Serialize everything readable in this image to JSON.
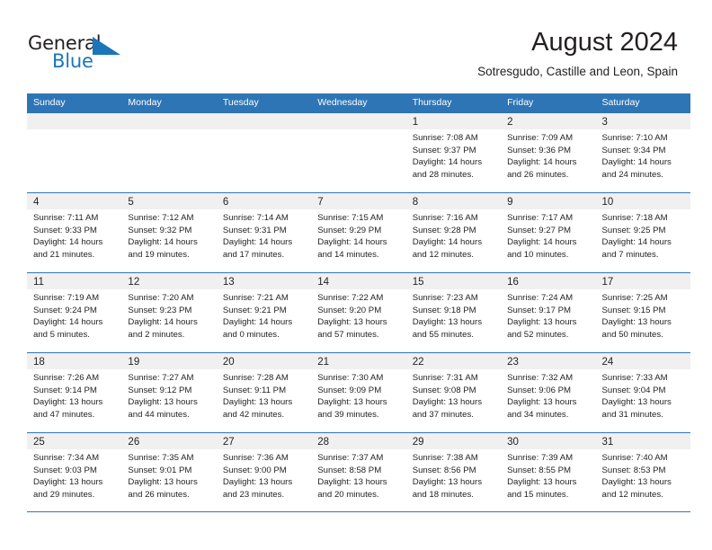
{
  "brand": {
    "general": "General",
    "blue": "Blue",
    "logo_icon": "triangle-flag-icon"
  },
  "header": {
    "month_title": "August 2024",
    "location": "Sotresgudo, Castille and Leon, Spain"
  },
  "calendar": {
    "weekday_headers": [
      "Sunday",
      "Monday",
      "Tuesday",
      "Wednesday",
      "Thursday",
      "Friday",
      "Saturday"
    ],
    "colors": {
      "header_blue": "#2e75b6",
      "daynum_band": "#f0f0f0",
      "brand_blue": "#1b75bb",
      "text": "#231f20"
    },
    "weeks": [
      [
        {
          "day": "",
          "lines": []
        },
        {
          "day": "",
          "lines": []
        },
        {
          "day": "",
          "lines": []
        },
        {
          "day": "",
          "lines": []
        },
        {
          "day": "1",
          "lines": [
            "Sunrise: 7:08 AM",
            "Sunset: 9:37 PM",
            "Daylight: 14 hours",
            "and 28 minutes."
          ]
        },
        {
          "day": "2",
          "lines": [
            "Sunrise: 7:09 AM",
            "Sunset: 9:36 PM",
            "Daylight: 14 hours",
            "and 26 minutes."
          ]
        },
        {
          "day": "3",
          "lines": [
            "Sunrise: 7:10 AM",
            "Sunset: 9:34 PM",
            "Daylight: 14 hours",
            "and 24 minutes."
          ]
        }
      ],
      [
        {
          "day": "4",
          "lines": [
            "Sunrise: 7:11 AM",
            "Sunset: 9:33 PM",
            "Daylight: 14 hours",
            "and 21 minutes."
          ]
        },
        {
          "day": "5",
          "lines": [
            "Sunrise: 7:12 AM",
            "Sunset: 9:32 PM",
            "Daylight: 14 hours",
            "and 19 minutes."
          ]
        },
        {
          "day": "6",
          "lines": [
            "Sunrise: 7:14 AM",
            "Sunset: 9:31 PM",
            "Daylight: 14 hours",
            "and 17 minutes."
          ]
        },
        {
          "day": "7",
          "lines": [
            "Sunrise: 7:15 AM",
            "Sunset: 9:29 PM",
            "Daylight: 14 hours",
            "and 14 minutes."
          ]
        },
        {
          "day": "8",
          "lines": [
            "Sunrise: 7:16 AM",
            "Sunset: 9:28 PM",
            "Daylight: 14 hours",
            "and 12 minutes."
          ]
        },
        {
          "day": "9",
          "lines": [
            "Sunrise: 7:17 AM",
            "Sunset: 9:27 PM",
            "Daylight: 14 hours",
            "and 10 minutes."
          ]
        },
        {
          "day": "10",
          "lines": [
            "Sunrise: 7:18 AM",
            "Sunset: 9:25 PM",
            "Daylight: 14 hours",
            "and 7 minutes."
          ]
        }
      ],
      [
        {
          "day": "11",
          "lines": [
            "Sunrise: 7:19 AM",
            "Sunset: 9:24 PM",
            "Daylight: 14 hours",
            "and 5 minutes."
          ]
        },
        {
          "day": "12",
          "lines": [
            "Sunrise: 7:20 AM",
            "Sunset: 9:23 PM",
            "Daylight: 14 hours",
            "and 2 minutes."
          ]
        },
        {
          "day": "13",
          "lines": [
            "Sunrise: 7:21 AM",
            "Sunset: 9:21 PM",
            "Daylight: 14 hours",
            "and 0 minutes."
          ]
        },
        {
          "day": "14",
          "lines": [
            "Sunrise: 7:22 AM",
            "Sunset: 9:20 PM",
            "Daylight: 13 hours",
            "and 57 minutes."
          ]
        },
        {
          "day": "15",
          "lines": [
            "Sunrise: 7:23 AM",
            "Sunset: 9:18 PM",
            "Daylight: 13 hours",
            "and 55 minutes."
          ]
        },
        {
          "day": "16",
          "lines": [
            "Sunrise: 7:24 AM",
            "Sunset: 9:17 PM",
            "Daylight: 13 hours",
            "and 52 minutes."
          ]
        },
        {
          "day": "17",
          "lines": [
            "Sunrise: 7:25 AM",
            "Sunset: 9:15 PM",
            "Daylight: 13 hours",
            "and 50 minutes."
          ]
        }
      ],
      [
        {
          "day": "18",
          "lines": [
            "Sunrise: 7:26 AM",
            "Sunset: 9:14 PM",
            "Daylight: 13 hours",
            "and 47 minutes."
          ]
        },
        {
          "day": "19",
          "lines": [
            "Sunrise: 7:27 AM",
            "Sunset: 9:12 PM",
            "Daylight: 13 hours",
            "and 44 minutes."
          ]
        },
        {
          "day": "20",
          "lines": [
            "Sunrise: 7:28 AM",
            "Sunset: 9:11 PM",
            "Daylight: 13 hours",
            "and 42 minutes."
          ]
        },
        {
          "day": "21",
          "lines": [
            "Sunrise: 7:30 AM",
            "Sunset: 9:09 PM",
            "Daylight: 13 hours",
            "and 39 minutes."
          ]
        },
        {
          "day": "22",
          "lines": [
            "Sunrise: 7:31 AM",
            "Sunset: 9:08 PM",
            "Daylight: 13 hours",
            "and 37 minutes."
          ]
        },
        {
          "day": "23",
          "lines": [
            "Sunrise: 7:32 AM",
            "Sunset: 9:06 PM",
            "Daylight: 13 hours",
            "and 34 minutes."
          ]
        },
        {
          "day": "24",
          "lines": [
            "Sunrise: 7:33 AM",
            "Sunset: 9:04 PM",
            "Daylight: 13 hours",
            "and 31 minutes."
          ]
        }
      ],
      [
        {
          "day": "25",
          "lines": [
            "Sunrise: 7:34 AM",
            "Sunset: 9:03 PM",
            "Daylight: 13 hours",
            "and 29 minutes."
          ]
        },
        {
          "day": "26",
          "lines": [
            "Sunrise: 7:35 AM",
            "Sunset: 9:01 PM",
            "Daylight: 13 hours",
            "and 26 minutes."
          ]
        },
        {
          "day": "27",
          "lines": [
            "Sunrise: 7:36 AM",
            "Sunset: 9:00 PM",
            "Daylight: 13 hours",
            "and 23 minutes."
          ]
        },
        {
          "day": "28",
          "lines": [
            "Sunrise: 7:37 AM",
            "Sunset: 8:58 PM",
            "Daylight: 13 hours",
            "and 20 minutes."
          ]
        },
        {
          "day": "29",
          "lines": [
            "Sunrise: 7:38 AM",
            "Sunset: 8:56 PM",
            "Daylight: 13 hours",
            "and 18 minutes."
          ]
        },
        {
          "day": "30",
          "lines": [
            "Sunrise: 7:39 AM",
            "Sunset: 8:55 PM",
            "Daylight: 13 hours",
            "and 15 minutes."
          ]
        },
        {
          "day": "31",
          "lines": [
            "Sunrise: 7:40 AM",
            "Sunset: 8:53 PM",
            "Daylight: 13 hours",
            "and 12 minutes."
          ]
        }
      ]
    ]
  }
}
